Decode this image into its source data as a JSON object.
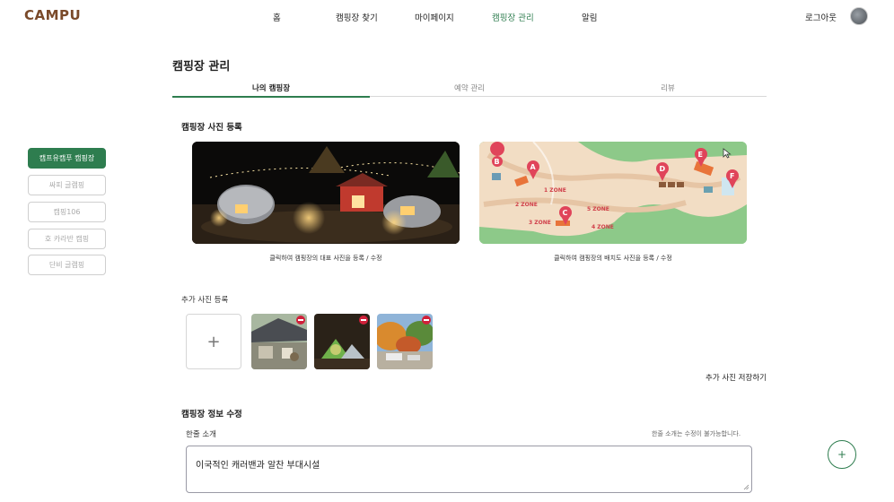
{
  "header": {
    "logo": "CAMPU",
    "nav": [
      "홈",
      "캠핑장 찾기",
      "마이페이지",
      "캠핑장 관리",
      "알림"
    ],
    "logout": "로그아웃"
  },
  "page": {
    "title": "캠핑장 관리",
    "tabs": [
      "나의 캠핑장",
      "예약 관리",
      "리뷰"
    ]
  },
  "sidebar": {
    "items": [
      "캠프유캠푸 캠핑장",
      "싸피 글램핑",
      "캠핑106",
      "호 카라반 캠핑",
      "단비 글램핑"
    ]
  },
  "photos": {
    "title": "캠핑장 사진 등록",
    "main_caption": "클릭하여 캠핑장의 대표 사진을 등록 / 수정",
    "map_caption": "클릭하여 캠핑장의 배치도 사진을 등록 / 수정",
    "map_pins": [
      "B",
      "A",
      "C",
      "D",
      "E",
      "F"
    ],
    "map_zones": [
      "1 ZONE",
      "2 ZONE",
      "3 ZONE",
      "5 ZONE",
      "4 ZONE"
    ]
  },
  "extra": {
    "title": "추가 사진 등록",
    "add_symbol": "+",
    "save_label": "추가 사진 저장하기"
  },
  "info": {
    "title": "캠핑장 정보 수정",
    "intro_label": "한줄 소개",
    "intro_note": "한줄 소개는 수정이 불가능합니다.",
    "intro_value": "이국적인 캐러밴과 알찬 부대시설"
  },
  "fab": {
    "symbol": "+"
  },
  "colors": {
    "accent": "#2e7d4f",
    "remove": "#d0203a"
  }
}
